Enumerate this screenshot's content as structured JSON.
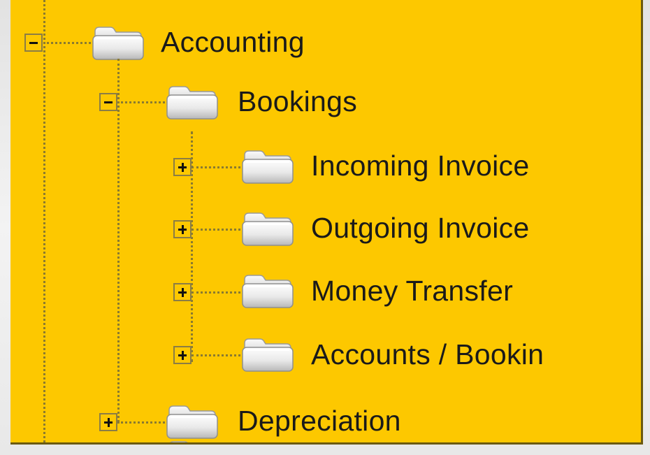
{
  "tree": {
    "items": [
      {
        "label": "Accounting",
        "state": "expanded",
        "level": 0
      },
      {
        "label": "Bookings",
        "state": "expanded",
        "level": 1
      },
      {
        "label": "Incoming Invoice",
        "state": "collapsed",
        "level": 2
      },
      {
        "label": "Outgoing Invoice",
        "state": "collapsed",
        "level": 2
      },
      {
        "label": "Money Transfer",
        "state": "collapsed",
        "level": 2
      },
      {
        "label": "Accounts / Bookin",
        "state": "collapsed",
        "level": 2
      },
      {
        "label": "Depreciation",
        "state": "collapsed",
        "level": 1
      }
    ]
  },
  "colors": {
    "panel_background": "#fdc800",
    "connector": "#8a7a30",
    "text": "#1a1a1a"
  },
  "icons": {
    "expanded": "minus-box-icon",
    "collapsed": "plus-box-icon",
    "node": "folder-icon"
  }
}
